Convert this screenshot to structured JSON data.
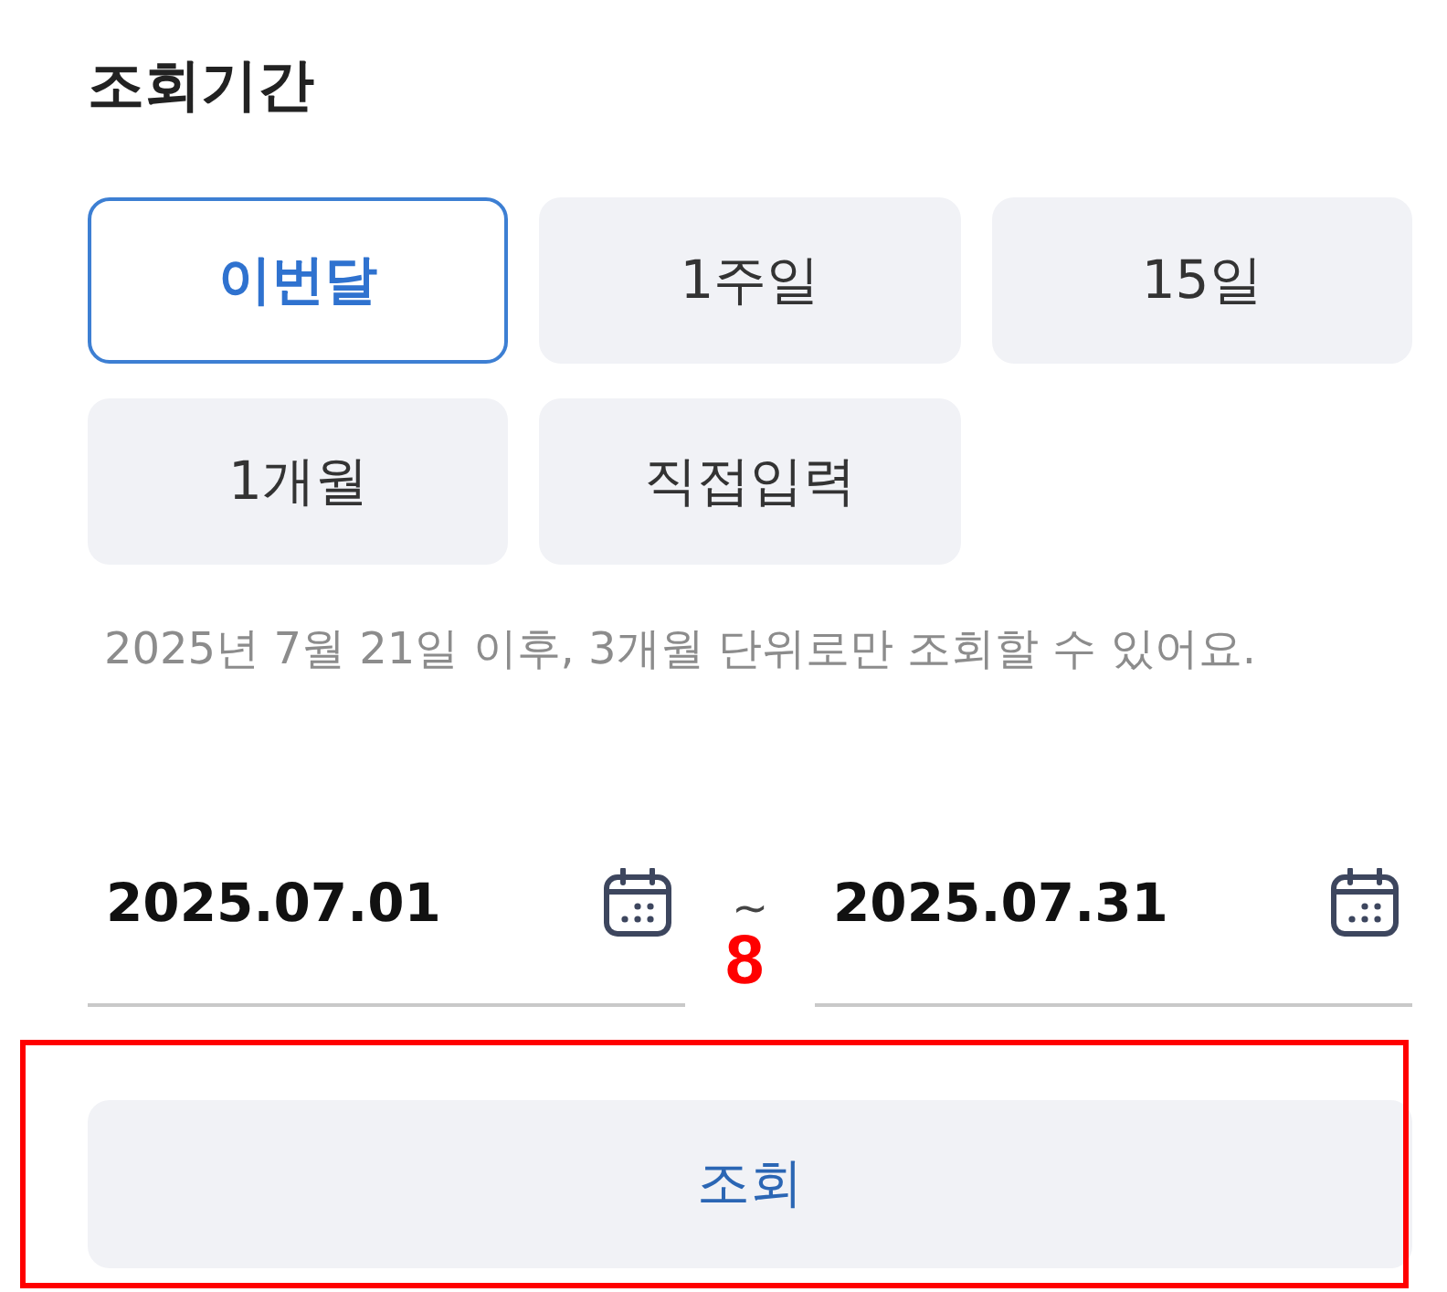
{
  "section": {
    "title": "조회기간"
  },
  "period_options": [
    {
      "label": "이번달",
      "selected": true
    },
    {
      "label": "1주일",
      "selected": false
    },
    {
      "label": "15일",
      "selected": false
    },
    {
      "label": "1개월",
      "selected": false
    },
    {
      "label": "직접입력",
      "selected": false
    }
  ],
  "notice": "2025년 7월 21일 이후, 3개월 단위로만 조회할 수 있어요.",
  "date_range": {
    "start": {
      "value": "2025.07.01"
    },
    "separator": "~",
    "end": {
      "value": "2025.07.31"
    }
  },
  "search_button": {
    "label": "조회"
  },
  "annotation": {
    "label": "8"
  }
}
